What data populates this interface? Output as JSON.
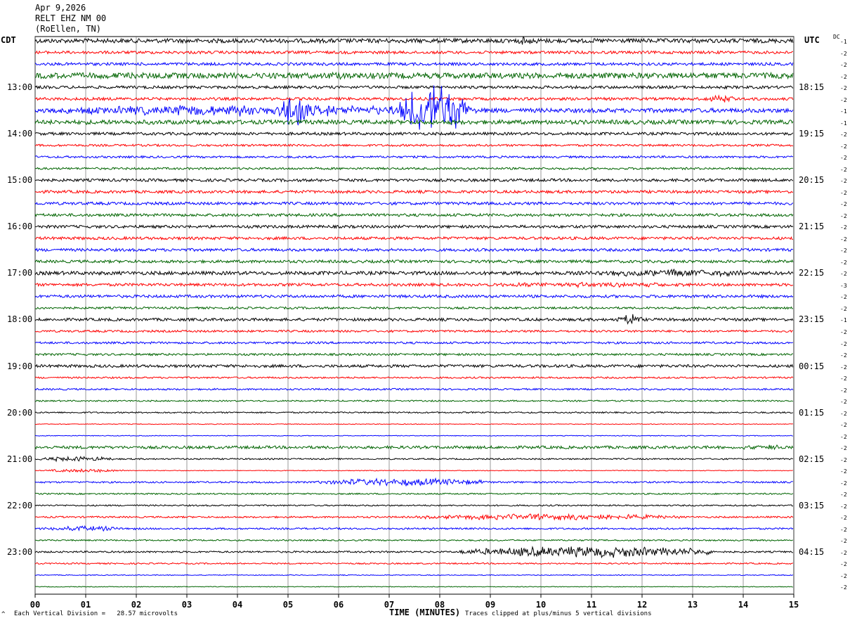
{
  "header": {
    "date": "Apr 9,2026",
    "station": "RELT EHZ NM 00",
    "location": "(RoEllen, TN)",
    "left_zone": "CDT",
    "right_zone": "UTC",
    "dc_label": "DC"
  },
  "footer": {
    "scale_note": "Each Vertical Division =   28.57 microvolts",
    "xlabel": "TIME (MINUTES)",
    "clip_note": "Traces clipped at plus/minus 5 vertical divisions",
    "corner_mark": "^"
  },
  "colors": {
    "trace_cycle": [
      "#000000",
      "#ff0000",
      "#0000ff",
      "#006400"
    ],
    "grid": "#000000"
  },
  "chart_data": {
    "type": "line",
    "title": "RELT EHZ NM 00",
    "xlabel": "TIME (MINUTES)",
    "xlim": [
      0,
      15
    ],
    "x_ticks": [
      "00",
      "01",
      "02",
      "03",
      "04",
      "05",
      "06",
      "07",
      "08",
      "09",
      "10",
      "11",
      "12",
      "13",
      "14",
      "15"
    ],
    "minutes_per_line": 15,
    "line_count": 48,
    "left_time_labels": [
      "13:00",
      "14:00",
      "15:00",
      "16:00",
      "17:00",
      "18:00",
      "19:00",
      "20:00",
      "21:00",
      "22:00",
      "23:00"
    ],
    "right_time_labels": [
      "18:15",
      "19:15",
      "20:15",
      "21:15",
      "22:15",
      "23:15",
      "00:15",
      "01:15",
      "02:15",
      "03:15",
      "04:15"
    ],
    "dc_offsets": [
      "-1",
      "-2",
      "-2",
      "-2",
      "-2",
      "-2",
      "-1",
      "-1",
      "-2",
      "-2",
      "-2",
      "-2",
      "-2",
      "-2",
      "-2",
      "-2",
      "-2",
      "-2",
      "-2",
      "-2",
      "-2",
      "-3",
      "-2",
      "-2",
      "-1",
      "-2",
      "-2",
      "-2",
      "-2",
      "-2",
      "-2",
      "-2",
      "-2",
      "-2",
      "-2",
      "-2",
      "-2",
      "-2",
      "-2",
      "-2",
      "-2",
      "-2",
      "-2",
      "-2",
      "-2",
      "-2",
      "-2",
      "-2"
    ],
    "trace_amplitude": [
      3,
      2,
      2,
      4,
      2,
      2,
      3,
      3,
      2,
      1.5,
      1.5,
      1.5,
      2,
      2,
      2,
      2,
      2,
      2,
      2,
      2,
      2.5,
      2,
      2,
      1.5,
      2,
      1.5,
      1.5,
      1.5,
      2,
      1.2,
      1.2,
      1,
      1,
      0.5,
      0.5,
      2,
      1,
      0.5,
      1.2,
      1,
      1,
      1.2,
      1.2,
      1,
      1.2,
      1,
      0.6,
      0.5
    ],
    "events": [
      {
        "line": 0,
        "start_min": 9.4,
        "end_min": 10.0,
        "amplitude": 6
      },
      {
        "line": 3,
        "start_min": 0.0,
        "end_min": 3.8,
        "amplitude": 5
      },
      {
        "line": 3,
        "start_min": 5.5,
        "end_min": 6.3,
        "amplitude": 6
      },
      {
        "line": 5,
        "start_min": 13.2,
        "end_min": 14.0,
        "amplitude": 6
      },
      {
        "line": 6,
        "start_min": 0.0,
        "end_min": 9.0,
        "amplitude": 9
      },
      {
        "line": 6,
        "start_min": 4.9,
        "end_min": 5.4,
        "amplitude": 35
      },
      {
        "line": 6,
        "start_min": 7.2,
        "end_min": 8.6,
        "amplitude": 40
      },
      {
        "line": 7,
        "start_min": 0.0,
        "end_min": 3.5,
        "amplitude": 4
      },
      {
        "line": 20,
        "start_min": 10.8,
        "end_min": 14.5,
        "amplitude": 6
      },
      {
        "line": 21,
        "start_min": 8.2,
        "end_min": 13.5,
        "amplitude": 4
      },
      {
        "line": 24,
        "start_min": 11.5,
        "end_min": 12.0,
        "amplitude": 9
      },
      {
        "line": 35,
        "start_min": 13.8,
        "end_min": 15.0,
        "amplitude": 4
      },
      {
        "line": 36,
        "start_min": 0.0,
        "end_min": 1.6,
        "amplitude": 4
      },
      {
        "line": 37,
        "start_min": 0.2,
        "end_min": 1.8,
        "amplitude": 3
      },
      {
        "line": 38,
        "start_min": 5.5,
        "end_min": 9.0,
        "amplitude": 6
      },
      {
        "line": 41,
        "start_min": 7.5,
        "end_min": 12.8,
        "amplitude": 5
      },
      {
        "line": 42,
        "start_min": 0.0,
        "end_min": 2.0,
        "amplitude": 4
      },
      {
        "line": 44,
        "start_min": 8.4,
        "end_min": 13.5,
        "amplitude": 9
      }
    ]
  }
}
